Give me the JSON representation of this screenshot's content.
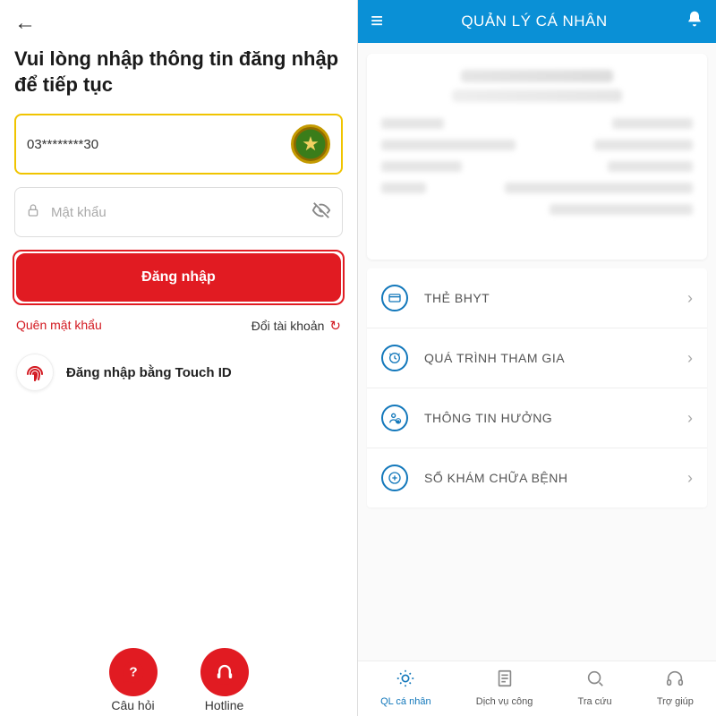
{
  "left": {
    "title": "Vui lòng nhập thông tin đăng nhập để tiếp tục",
    "username_value": "03********30",
    "password_placeholder": "Mật khẩu",
    "login_button": "Đăng nhập",
    "forgot_label": "Quên mật khẩu",
    "switch_label": "Đổi tài khoản",
    "touchid_label": "Đăng nhập bằng Touch ID",
    "footer": {
      "faq": "Câu hỏi",
      "hotline": "Hotline"
    }
  },
  "right": {
    "header_title": "QUẢN LÝ CÁ NHÂN",
    "menu": [
      {
        "label": "THẺ BHYT"
      },
      {
        "label": "QUÁ TRÌNH THAM GIA"
      },
      {
        "label": "THÔNG TIN HƯỞNG"
      },
      {
        "label": "SỔ KHÁM CHỮA BỆNH"
      }
    ],
    "tabs": {
      "personal": "QL cá nhân",
      "service": "Dịch vụ công",
      "lookup": "Tra cứu",
      "help": "Trợ giúp"
    }
  }
}
